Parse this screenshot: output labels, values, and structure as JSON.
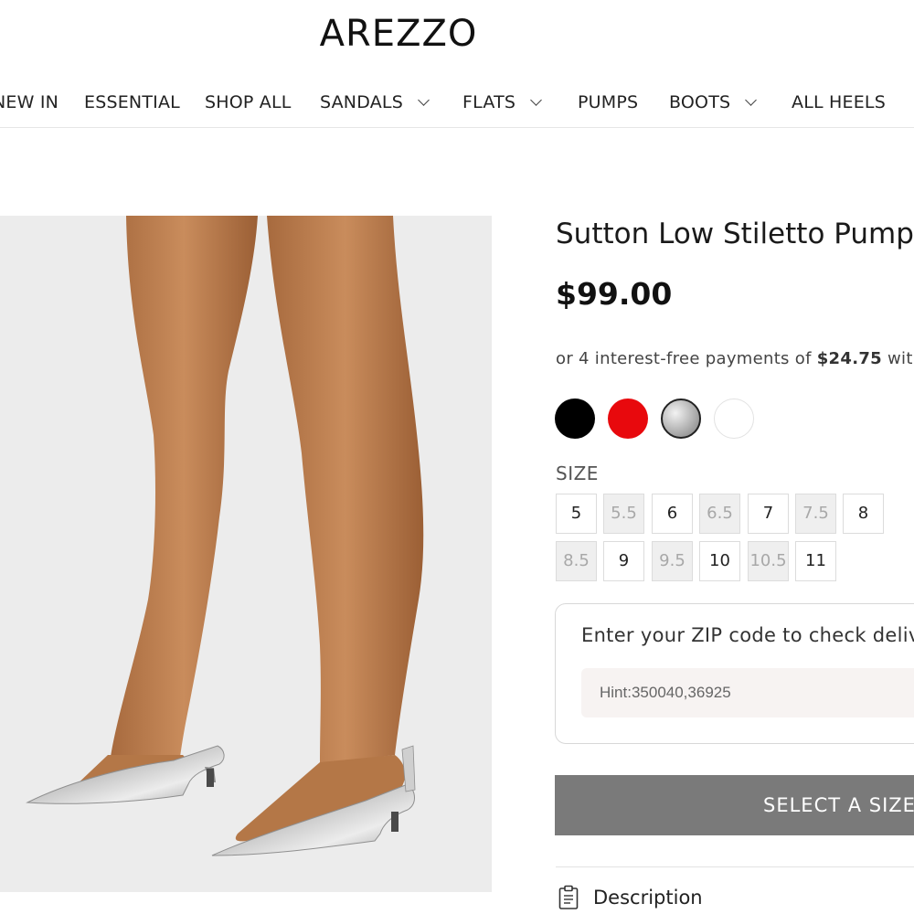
{
  "header": {
    "logo": "AREZZO",
    "nav": [
      {
        "label": "NEW IN",
        "dropdown": false
      },
      {
        "label": "ESSENTIAL",
        "dropdown": false
      },
      {
        "label": "SHOP ALL",
        "dropdown": false
      },
      {
        "label": "SANDALS",
        "dropdown": true
      },
      {
        "label": "FLATS",
        "dropdown": true
      },
      {
        "label": "PUMPS",
        "dropdown": false
      },
      {
        "label": "BOOTS",
        "dropdown": true
      },
      {
        "label": "ALL HEELS",
        "dropdown": false
      }
    ]
  },
  "product": {
    "title": "Sutton Low Stiletto Pump",
    "price": "$99.00",
    "installments": {
      "prefix": "or 4 interest-free payments of ",
      "amount": "$24.75",
      "suffix": " with"
    },
    "colors": [
      {
        "name": "black",
        "hex": "#000000",
        "selected": false
      },
      {
        "name": "red",
        "hex": "#e8090d",
        "selected": false
      },
      {
        "name": "silver",
        "hex": "#b8b8b8",
        "selected": true
      },
      {
        "name": "white",
        "hex": "#ffffff",
        "selected": false
      }
    ],
    "size_label": "SIZE",
    "sizes": [
      {
        "label": "5",
        "available": true
      },
      {
        "label": "5.5",
        "available": false
      },
      {
        "label": "6",
        "available": true
      },
      {
        "label": "6.5",
        "available": false
      },
      {
        "label": "7",
        "available": true
      },
      {
        "label": "7.5",
        "available": false
      },
      {
        "label": "8",
        "available": true
      },
      {
        "label": "8.5",
        "available": false
      },
      {
        "label": "9",
        "available": true
      },
      {
        "label": "9.5",
        "available": false
      },
      {
        "label": "10",
        "available": true
      },
      {
        "label": "10.5",
        "available": false
      },
      {
        "label": "11",
        "available": true
      }
    ],
    "zip": {
      "title": "Enter your ZIP code to check delivery",
      "placeholder": "Hint:350040,36925",
      "value": ""
    },
    "cta_label": "SELECT A SIZE",
    "description_label": "Description"
  },
  "icons": {
    "nav_dropdown": "chevron-down-icon",
    "description": "clipboard-icon"
  },
  "colors": {
    "cta_background": "#7a7a7a",
    "unavailable_size_bg": "#efefef",
    "zip_input_bg": "#f7f3f2"
  }
}
